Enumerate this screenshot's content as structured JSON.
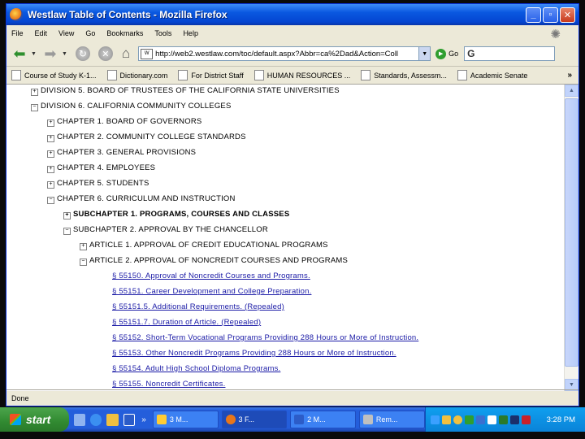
{
  "window": {
    "title": "Westlaw Table of Contents - Mozilla Firefox",
    "min_glyph": "_",
    "max_glyph": "▫",
    "close_glyph": "✕"
  },
  "menu": {
    "items": [
      "File",
      "Edit",
      "View",
      "Go",
      "Bookmarks",
      "Tools",
      "Help"
    ]
  },
  "nav": {
    "url": "http://web2.westlaw.com/toc/default.aspx?Abbr=ca%2Dad&Action=Coll",
    "go_label": "Go",
    "search_value": "G"
  },
  "bookmarks": {
    "items": [
      "Course of Study K-1...",
      "Dictionary.com",
      "For District Staff",
      "HUMAN RESOURCES ...",
      "Standards, Assessm...",
      "Academic Senate"
    ],
    "more": "»"
  },
  "toc": [
    {
      "text": "DIVISION 5. BOARD OF TRUSTEES OF THE CALIFORNIA STATE UNIVERSITIES",
      "toggle": "+",
      "level": 0,
      "style": "plain"
    },
    {
      "text": "DIVISION 6. CALIFORNIA COMMUNITY COLLEGES",
      "toggle": "−",
      "level": 0,
      "style": "plain"
    },
    {
      "text": "CHAPTER 1. BOARD OF GOVERNORS",
      "toggle": "+",
      "level": 1,
      "style": "plain"
    },
    {
      "text": "CHAPTER 2. COMMUNITY COLLEGE STANDARDS",
      "toggle": "+",
      "level": 1,
      "style": "plain"
    },
    {
      "text": "CHAPTER 3. GENERAL PROVISIONS",
      "toggle": "+",
      "level": 1,
      "style": "plain"
    },
    {
      "text": "CHAPTER 4. EMPLOYEES",
      "toggle": "+",
      "level": 1,
      "style": "plain"
    },
    {
      "text": "CHAPTER 5. STUDENTS",
      "toggle": "+",
      "level": 1,
      "style": "plain"
    },
    {
      "text": "CHAPTER 6. CURRICULUM AND INSTRUCTION",
      "toggle": "−",
      "level": 1,
      "style": "plain"
    },
    {
      "text": "SUBCHAPTER 1. PROGRAMS, COURSES AND CLASSES",
      "toggle": "+",
      "level": 2,
      "style": "bold"
    },
    {
      "text": "SUBCHAPTER 2. APPROVAL BY THE CHANCELLOR",
      "toggle": "−",
      "level": 2,
      "style": "plain"
    },
    {
      "text": "ARTICLE 1. APPROVAL OF CREDIT EDUCATIONAL PROGRAMS",
      "toggle": "+",
      "level": 3,
      "style": "plain"
    },
    {
      "text": "ARTICLE 2. APPROVAL OF NONCREDIT COURSES AND PROGRAMS",
      "toggle": "−",
      "level": 3,
      "style": "plain"
    },
    {
      "text": "§ 55150. Approval of Noncredit Courses and Programs.",
      "toggle": "",
      "level": 4,
      "style": "link"
    },
    {
      "text": "§ 55151. Career Development and College Preparation.",
      "toggle": "",
      "level": 4,
      "style": "link"
    },
    {
      "text": "§ 55151.5. Additional Requirements. (Repealed)",
      "toggle": "",
      "level": 4,
      "style": "link"
    },
    {
      "text": "§ 55151.7. Duration of Article. (Repealed)",
      "toggle": "",
      "level": 4,
      "style": "link"
    },
    {
      "text": "§ 55152. Short-Term Vocational Programs Providing 288 Hours or More of Instruction.",
      "toggle": "",
      "level": 4,
      "style": "link"
    },
    {
      "text": "§ 55153. Other Noncredit Programs Providing 288 Hours or More of Instruction.",
      "toggle": "",
      "level": 4,
      "style": "link"
    },
    {
      "text": "§ 55154. Adult High School Diploma Programs.",
      "toggle": "",
      "level": 4,
      "style": "link"
    },
    {
      "text": "§ 55155. Noncredit Certificates.",
      "toggle": "",
      "level": 4,
      "style": "link"
    }
  ],
  "status": {
    "text": "Done"
  },
  "taskbar": {
    "start": "start",
    "ql_more": "»",
    "tasks": [
      "3 M...",
      "3 F...",
      "2 M...",
      "Rem..."
    ],
    "clock": "3:28 PM"
  }
}
